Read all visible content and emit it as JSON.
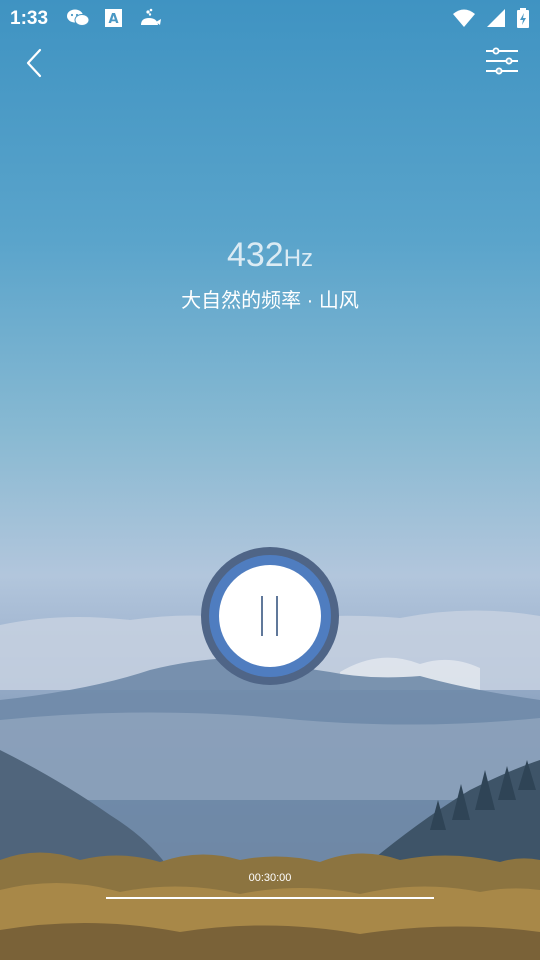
{
  "status_bar": {
    "time": "1:33",
    "left_icons": [
      "wechat-icon",
      "font-a-icon",
      "whale-icon"
    ],
    "right_icons": [
      "wifi-icon",
      "signal-icon",
      "battery-icon"
    ]
  },
  "header": {
    "back_icon": "back-chevron-icon",
    "settings_icon": "sliders-icon"
  },
  "track": {
    "frequency_value": "432",
    "frequency_unit": "Hz",
    "title": "大自然的频率 · 山风"
  },
  "player": {
    "state_icon": "pause-icon",
    "timer": "00:30:00",
    "progress": 1.0,
    "colors": {
      "outer_ring": "#4f6587",
      "inner_ring": "#4f7dc0",
      "button_face": "#ffffff",
      "pause_bars": "#4f6a8f"
    }
  }
}
